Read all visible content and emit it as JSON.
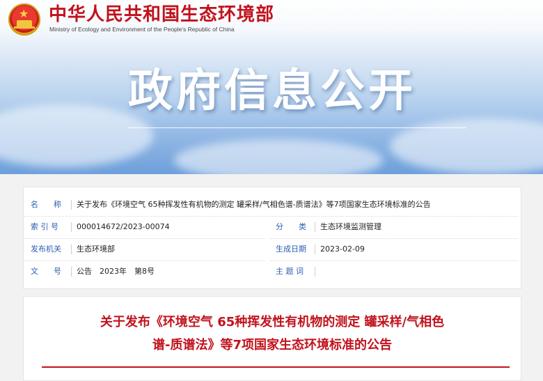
{
  "header": {
    "ministry_cn": "中华人民共和国生态环境部",
    "ministry_en": "Ministry of Ecology and Environment of the People's Republic of China",
    "hero_title": "政府信息公开"
  },
  "meta": {
    "name_label": "名　　称",
    "name_value": "关于发布《环境空气 65种挥发性有机物的测定 罐采样/气相色谱-质谱法》等7项国家生态环境标准的公告",
    "index_label": "索 引 号",
    "index_value": "000014672/2023-00074",
    "category_label": "分　　类",
    "category_value": "生态环境监测管理",
    "issuer_label": "发布机关",
    "issuer_value": "生态环境部",
    "date_label": "生成日期",
    "date_value": "2023-02-09",
    "docno_label": "文　　号",
    "docno_value": "公告　2023年　第8号",
    "subject_label": "主 题 词",
    "subject_value": ""
  },
  "article": {
    "title_line1": "关于发布《环境空气 65种挥发性有机物的测定 罐采样/气相色",
    "title_line2": "谱-质谱法》等7项国家生态环境标准的公告"
  },
  "colors": {
    "brand_red": "#c1121c",
    "label_blue": "#2a5db0"
  }
}
